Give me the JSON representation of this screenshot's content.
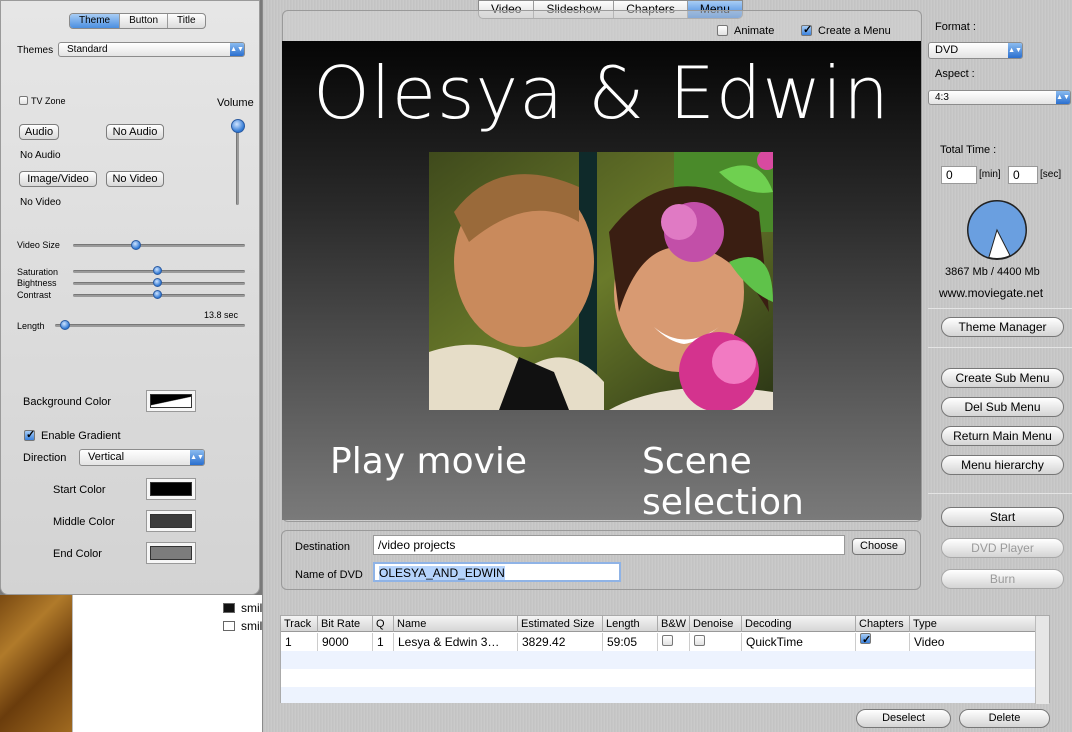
{
  "inspector": {
    "segments": [
      "Theme",
      "Button",
      "Title"
    ],
    "themes_label": "Themes",
    "themes_value": "Standard",
    "tv_zone": "TV Zone",
    "volume": "Volume",
    "audio_button": "Audio",
    "no_audio_button": "No Audio",
    "no_audio_text": "No Audio",
    "image_video_button": "Image/Video",
    "no_video_button": "No Video",
    "no_video_text": "No Video",
    "video_size": "Video Size",
    "saturation": "Saturation",
    "brightness": "Bightness",
    "contrast": "Contrast",
    "length_value": "13.8 sec",
    "length": "Length",
    "background_color": "Background Color",
    "enable_gradient": "Enable Gradient",
    "direction": "Direction",
    "direction_value": "Vertical",
    "start_color": "Start Color",
    "middle_color": "Middle Color",
    "end_color": "End Color",
    "colors": {
      "start": "#000000",
      "middle": "#3c3c3c",
      "end": "#7c7c7c"
    },
    "volume_level": 1.0,
    "video_size_level": 0.36,
    "saturation_level": 0.49,
    "brightness_level": 0.49,
    "contrast_level": 0.49,
    "length_level": 0.03
  },
  "main": {
    "tabs": [
      "Video",
      "Slideshow",
      "Chapters",
      "Menu"
    ],
    "selected_tab": "Menu",
    "animate": "Animate",
    "create_menu": "Create a Menu",
    "menu_title": "Olesya & Edwin",
    "play_movie": "Play movie",
    "scene_selection": "Scene selection",
    "destination_label": "Destination",
    "destination_value": "/video projects",
    "choose_button": "Choose",
    "name_label": "Name of DVD",
    "name_value": "OLESYA_AND_EDWIN"
  },
  "right": {
    "format_label": "Format :",
    "format_value": "DVD",
    "aspect_label": "Aspect :",
    "aspect_value": "4:3",
    "total_time_label": "Total Time :",
    "min_value": "0",
    "min_unit": "[min]",
    "sec_value": "0",
    "sec_unit": "[sec]",
    "usage": "3867 Mb / 4400 Mb",
    "website": "www.moviegate.net",
    "theme_manager": "Theme Manager",
    "create_sub_menu": "Create Sub Menu",
    "del_sub_menu": "Del Sub Menu",
    "return_main_menu": "Return Main Menu",
    "menu_hierarchy": "Menu hierarchy",
    "start": "Start",
    "dvd_player": "DVD Player",
    "burn": "Burn",
    "usage_fraction": 0.879
  },
  "table": {
    "headers": [
      "Track",
      "Bit Rate",
      "Q",
      "Name",
      "Estimated Size",
      "Length",
      "B&W",
      "Denoise",
      "Decoding",
      "Chapters",
      "Type"
    ],
    "rows": [
      {
        "track": "1",
        "bitrate": "9000",
        "q": "1",
        "name": "Lesya & Edwin 3…",
        "size": "3829.42",
        "length": "59:05",
        "decoding": "QuickTime",
        "type": "Video"
      }
    ],
    "deselect": "Deselect",
    "delete": "Delete"
  },
  "finder": {
    "file1": "smil",
    "file2": "smile"
  }
}
